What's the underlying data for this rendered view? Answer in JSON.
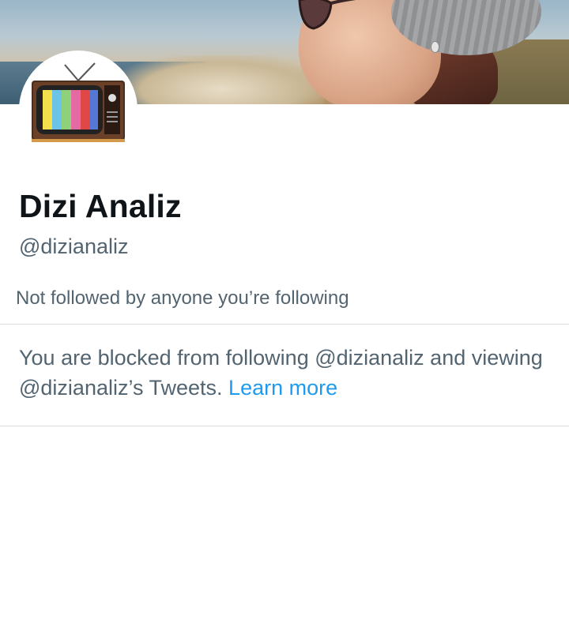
{
  "profile": {
    "display_name": "Dizi Analiz",
    "handle": "@dizianaliz",
    "not_followed_text": "Not followed by anyone you’re following"
  },
  "blocked_notice": {
    "text": "You are blocked from following @dizianaliz and viewing @dizianaliz’s Tweets.",
    "link_label": "Learn more"
  },
  "icons": {
    "avatar": "retro-tv-icon"
  },
  "colors": {
    "text_primary": "#0f1419",
    "text_secondary": "#536471",
    "link": "#1d9bf0",
    "divider": "#d9dde0"
  }
}
